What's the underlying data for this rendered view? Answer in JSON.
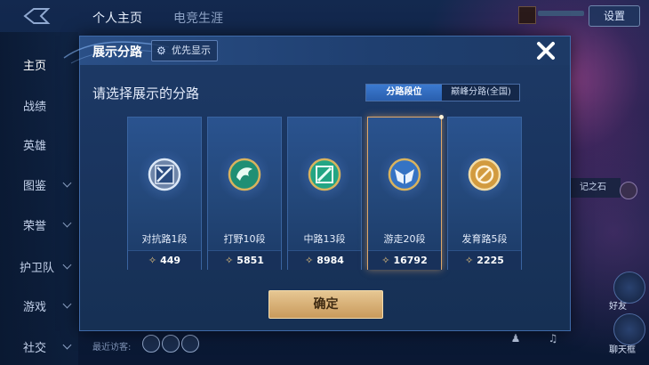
{
  "top_tabs": [
    "个人主页",
    "电竞生涯"
  ],
  "settings_label": "设置",
  "sidebar": {
    "items": [
      {
        "label": "主页",
        "has_arrow": false
      },
      {
        "label": "战绩",
        "has_arrow": false
      },
      {
        "label": "英雄",
        "has_arrow": false
      },
      {
        "label": "图鉴",
        "has_arrow": true
      },
      {
        "label": "荣誉",
        "has_arrow": true
      },
      {
        "label": "护卫队",
        "has_arrow": true
      },
      {
        "label": "游戏",
        "has_arrow": true
      },
      {
        "label": "社交",
        "has_arrow": true
      }
    ]
  },
  "bottom": {
    "recent_visitors": "最近访客:"
  },
  "right_panel": {
    "strip_text": "记之石",
    "btn1_label": "好友",
    "btn2_label": "聊天框"
  },
  "dialog": {
    "title": "展示分路",
    "priority_label": "优先显示",
    "subtitle": "请选择展示的分路",
    "segment": {
      "active": "分路段位",
      "inactive": "巅峰分路(全国)"
    },
    "confirm_label": "确定",
    "cards": [
      {
        "name": "对抗路1段",
        "score": "449",
        "icon": "clash-lane-icon",
        "selected": false,
        "color": "#9fb6d6"
      },
      {
        "name": "打野10段",
        "score": "5851",
        "icon": "jungle-icon",
        "selected": false,
        "color": "#2fae8f"
      },
      {
        "name": "中路13段",
        "score": "8984",
        "icon": "mid-lane-icon",
        "selected": false,
        "color": "#3cc7a0"
      },
      {
        "name": "游走20段",
        "score": "16792",
        "icon": "roam-icon",
        "selected": true,
        "color": "#4a86d8"
      },
      {
        "name": "发育路5段",
        "score": "2225",
        "icon": "farm-lane-icon",
        "selected": false,
        "color": "#d9a24a"
      }
    ]
  },
  "colors": {
    "accent_gold": "#c99a5c",
    "segment_active": "#3b7ad0",
    "dialog_bg": "#1a3560"
  }
}
